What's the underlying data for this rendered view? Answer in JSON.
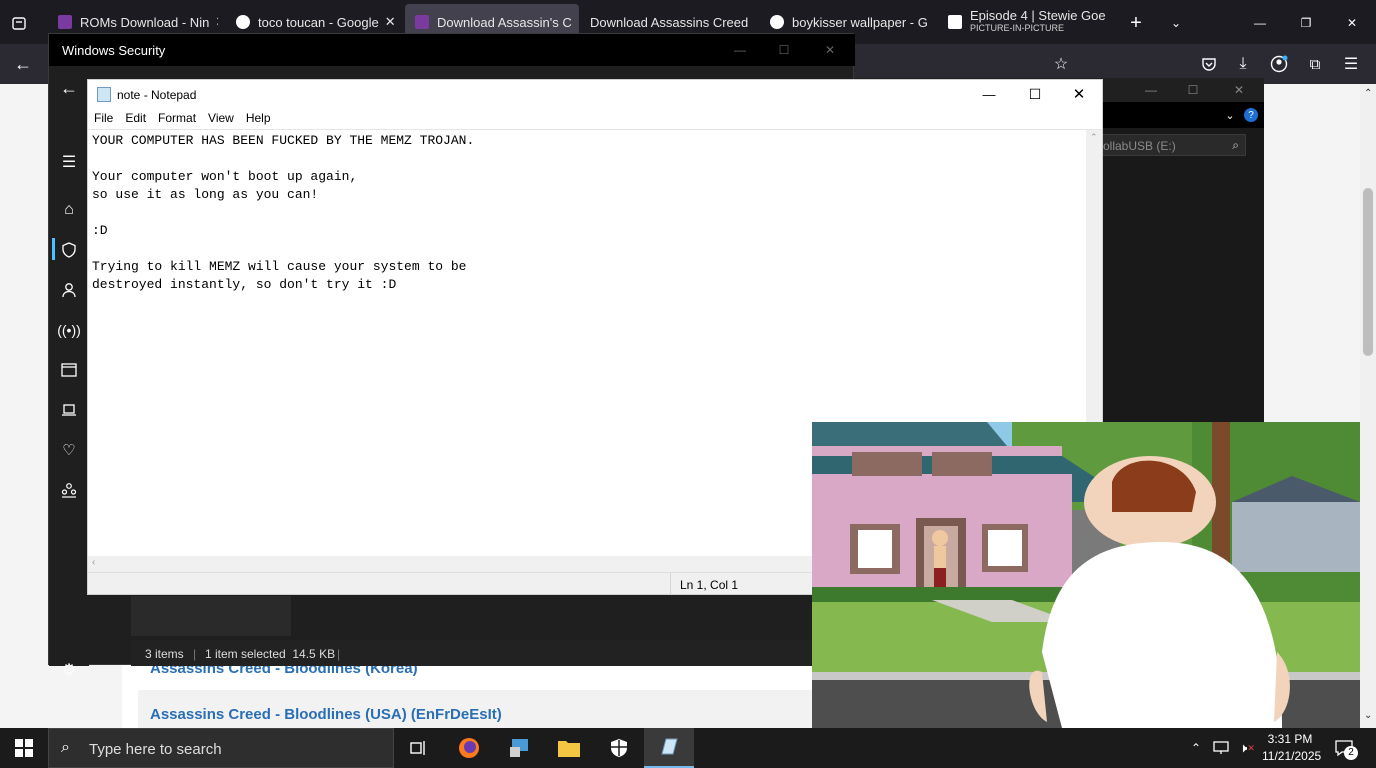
{
  "browser": {
    "tabs": [
      {
        "label": "ROMs Download - Nin",
        "favicon": "site-icon",
        "color": "#7a3aa0"
      },
      {
        "label": "toco toucan - Google",
        "favicon": "google-icon",
        "color": "#ffffff"
      },
      {
        "label": "Download Assassin's C",
        "favicon": "site-icon",
        "color": "#7a3aa0",
        "active": true
      },
      {
        "label": "Download Assassins Creed",
        "favicon": "",
        "color": ""
      },
      {
        "label": "boykisser wallpaper - G",
        "favicon": "google-icon",
        "color": "#ffffff"
      },
      {
        "label": "Episode 4 | Stewie Goe",
        "sub": "PICTURE-IN-PICTURE",
        "favicon": "pip-icon",
        "color": "#ffffff"
      }
    ],
    "new_tab": "+",
    "links": [
      "Assassins Creed - Bloodlines (Korea)",
      "Assassins Creed - Bloodlines (USA) (EnFrDeEsIt)"
    ]
  },
  "windows_security": {
    "title": "Windows Security"
  },
  "explorer": {
    "search_placeholder": "ollabUSB (E:)",
    "status": [
      "3 items",
      "1 item selected  14.5 KB"
    ],
    "help": "?"
  },
  "notepad": {
    "title": "note - Notepad",
    "menu": [
      "File",
      "Edit",
      "Format",
      "View",
      "Help"
    ],
    "content": "YOUR COMPUTER HAS BEEN FUCKED BY THE MEMZ TROJAN.\n\nYour computer won't boot up again,\nso use it as long as you can!\n\n:D\n\nTrying to kill MEMZ will cause your system to be\ndestroyed instantly, so don't try it :D",
    "status": "Ln 1, Col 1"
  },
  "taskbar": {
    "search_placeholder": "Type here to search",
    "time": "3:31 PM",
    "date": "11/21/2025",
    "notifications": "2"
  },
  "colors": {
    "accent": "#2a6fb5",
    "tabbar": "#1c1b22",
    "navbar": "#2b2a33"
  }
}
